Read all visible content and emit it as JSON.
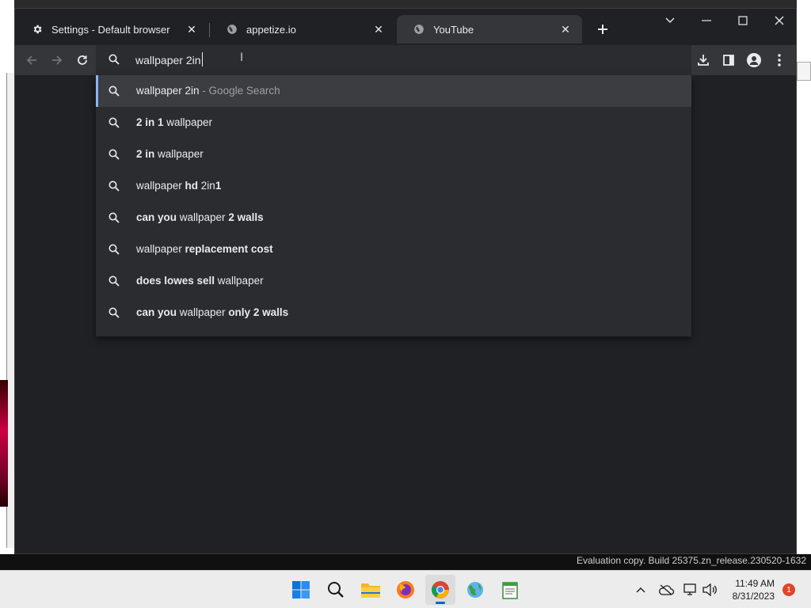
{
  "browser": {
    "tabs": [
      {
        "title": "Settings - Default browser",
        "icon": "gear-icon"
      },
      {
        "title": "appetize.io",
        "icon": "globe-icon"
      },
      {
        "title": "YouTube",
        "icon": "globe-icon"
      }
    ],
    "active_tab": 2,
    "omnibox": {
      "value": "wallpaper 2in"
    },
    "suggestions": [
      {
        "parts": [
          {
            "t": "wallpaper 2in",
            "b": false
          }
        ],
        "suffix": " - Google Search"
      },
      {
        "parts": [
          {
            "t": "2 in 1",
            "b": true
          },
          {
            "t": " wallpaper",
            "b": false
          }
        ]
      },
      {
        "parts": [
          {
            "t": "2 in",
            "b": true
          },
          {
            "t": " wallpaper",
            "b": false
          }
        ]
      },
      {
        "parts": [
          {
            "t": "wallpaper ",
            "b": false
          },
          {
            "t": "hd",
            "b": true
          },
          {
            "t": " 2in",
            "b": false
          },
          {
            "t": "1",
            "b": true
          }
        ]
      },
      {
        "parts": [
          {
            "t": "can you",
            "b": true
          },
          {
            "t": " wallpaper ",
            "b": false
          },
          {
            "t": "2 walls",
            "b": true
          }
        ]
      },
      {
        "parts": [
          {
            "t": "wallpaper ",
            "b": false
          },
          {
            "t": "replacement cost",
            "b": true
          }
        ]
      },
      {
        "parts": [
          {
            "t": "does lowes sell",
            "b": true
          },
          {
            "t": " wallpaper",
            "b": false
          }
        ]
      },
      {
        "parts": [
          {
            "t": "can you",
            "b": true
          },
          {
            "t": " wallpaper ",
            "b": false
          },
          {
            "t": "only 2 walls",
            "b": true
          }
        ]
      }
    ]
  },
  "desktop": {
    "watermark": "Evaluation copy. Build 25375.zn_release.230520-1632"
  },
  "taskbar": {
    "time": "11:49 AM",
    "date": "8/31/2023",
    "notification_count": "1"
  },
  "colors": {
    "accent": "#8ab4f8",
    "window_bg": "#202124",
    "toolbar_bg": "#35363a"
  }
}
